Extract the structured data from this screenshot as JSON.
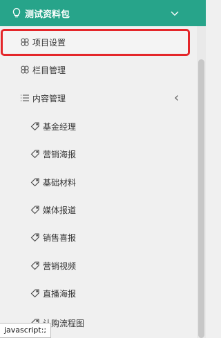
{
  "header": {
    "title": "测试资料包",
    "icon": "lightbulb-icon",
    "toggle_icon": "chevron-down-icon"
  },
  "colors": {
    "header_bg": "#27a48a",
    "highlight_border": "#e4262a",
    "sidebar_bg": "#f0f0f0"
  },
  "menu": {
    "project_settings": {
      "label": "项目设置",
      "icon": "clover-icon",
      "highlighted": true
    },
    "column_management": {
      "label": "栏目管理",
      "icon": "clover-icon"
    },
    "content_management": {
      "label": "内容管理",
      "icon": "list-icon",
      "expand_icon": "chevron-left-icon"
    },
    "sub_items": [
      {
        "label": "基金经理",
        "icon": "tag-icon"
      },
      {
        "label": "营销海报",
        "icon": "tag-icon"
      },
      {
        "label": "基础材料",
        "icon": "tag-icon"
      },
      {
        "label": "媒体报道",
        "icon": "tag-icon"
      },
      {
        "label": "销售喜报",
        "icon": "tag-icon"
      },
      {
        "label": "营销视频",
        "icon": "tag-icon"
      },
      {
        "label": "直播海报",
        "icon": "tag-icon"
      },
      {
        "label": "认购流程图",
        "icon": "tag-icon"
      }
    ]
  },
  "status_bar": {
    "text": "javascript:;"
  }
}
